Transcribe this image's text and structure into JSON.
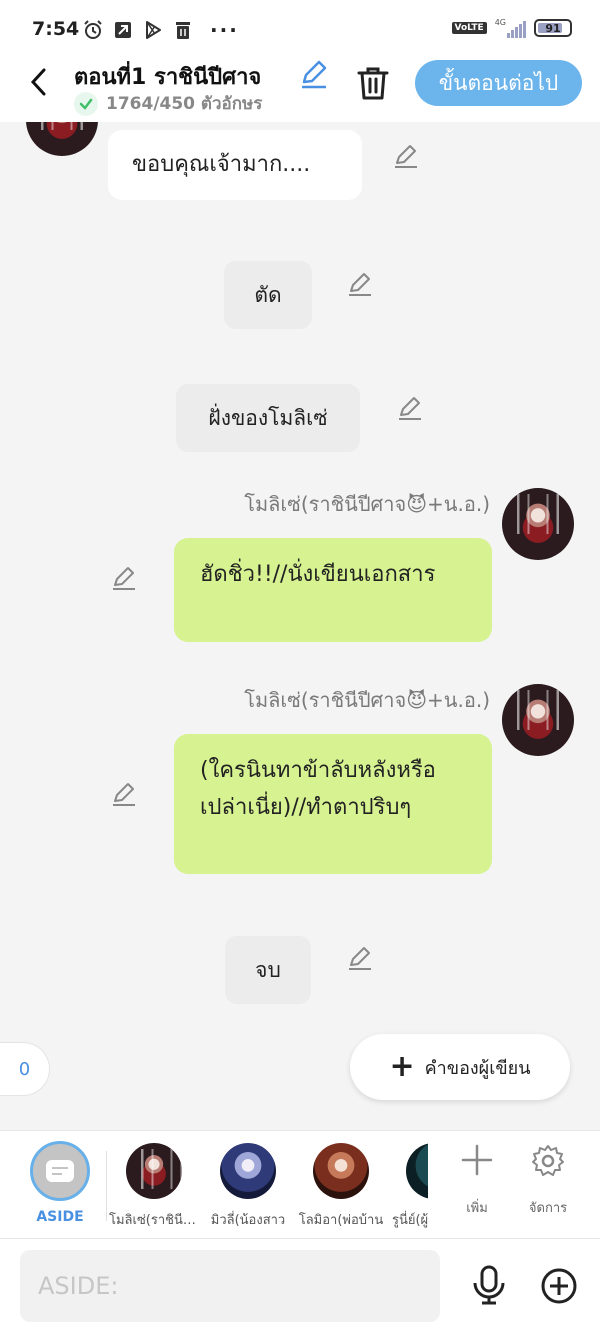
{
  "status_bar": {
    "time": "7:54",
    "more": "···",
    "volte": "VoLTE",
    "network": "4G",
    "battery": "91"
  },
  "header": {
    "title": "ตอนที่1 ราชินีปีศาจ",
    "count": "1764/450 ตัวอักษร",
    "next_label": "ขั้นตอนต่อไป"
  },
  "messages": [
    {
      "type": "narration",
      "text": "ขอบคุณเจ้ามาก...."
    },
    {
      "type": "narration",
      "text": "ตัด"
    },
    {
      "type": "narration",
      "text": "ฝั่งของโมลิเซ่"
    },
    {
      "type": "dialogue",
      "speaker": "โมลิเซ่(ราชินีปีศาจ😈+น.อ.)",
      "text": "ฮัดชิ่ว!!//นั่งเขียนเอกสาร"
    },
    {
      "type": "dialogue",
      "speaker": "โมลิเซ่(ราชินีปีศาจ😈+น.อ.)",
      "text": "(ใครนินทาข้าลับหลังหรือเปล่าเนี่ย)//ทำตาปริบๆ"
    },
    {
      "type": "narration",
      "text": "จบ"
    }
  ],
  "counter": "0",
  "writer_button": {
    "label": "คำของผู้เขียน"
  },
  "characters": {
    "aside_label": "ASIDE",
    "items": [
      {
        "label": "โมลิเซ่(ราชินีปีศาจ"
      },
      {
        "label": "มิวลี่(น้องสาว"
      },
      {
        "label": "โลมิอา(พ่อบ้าน"
      },
      {
        "label": "รูนี่ย์(ผู้"
      }
    ],
    "add_label": "เพิ่ม",
    "manage_label": "จัดการ"
  },
  "input": {
    "placeholder": "ASIDE:"
  },
  "colors": {
    "accent": "#6cb4ec",
    "green_bubble": "#d6f291",
    "background": "#f4f4f4"
  }
}
